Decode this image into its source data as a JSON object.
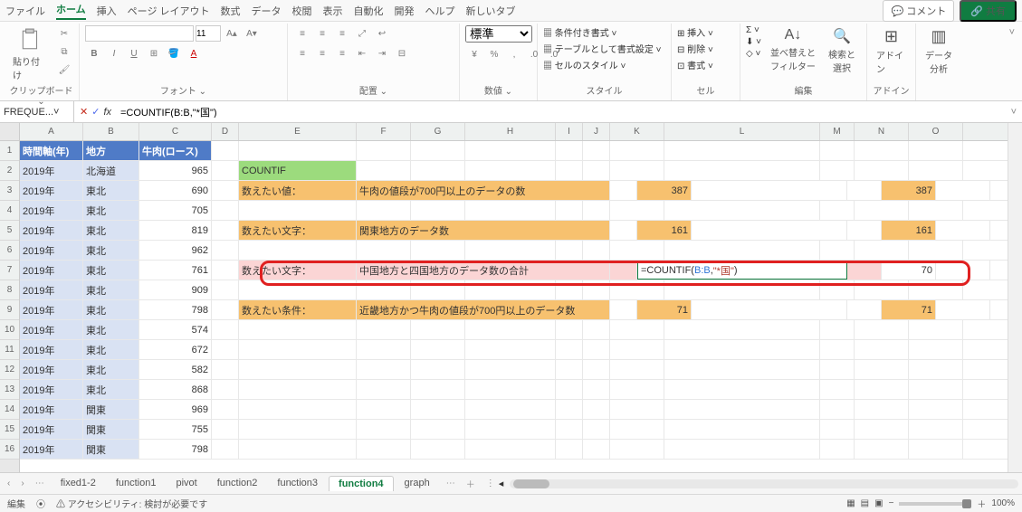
{
  "menu": {
    "items": [
      "ファイル",
      "ホーム",
      "挿入",
      "ページ レイアウト",
      "数式",
      "データ",
      "校閲",
      "表示",
      "自動化",
      "開発",
      "ヘルプ",
      "新しいタブ"
    ],
    "active": 1,
    "comment": "コメント",
    "share": "共有"
  },
  "ribbon": {
    "clipboard": {
      "paste": "貼り付け",
      "label": "クリップボード"
    },
    "font": {
      "family": "",
      "size": "11",
      "label": "フォント"
    },
    "align": {
      "label": "配置"
    },
    "number": {
      "format": "標準",
      "label": "数値"
    },
    "styles": {
      "cond": "条件付き書式",
      "table": "テーブルとして書式設定",
      "cell": "セルのスタイル",
      "label": "スタイル"
    },
    "cells": {
      "insert": "挿入",
      "delete": "削除",
      "format": "書式",
      "label": "セル"
    },
    "editing": {
      "sort": "並べ替えと\nフィルター",
      "find": "検索と\n選択",
      "label": "編集"
    },
    "addin": {
      "name": "アドイン",
      "label": "アドイン"
    },
    "analysis": {
      "name": "データ\n分析",
      "label": ""
    }
  },
  "formula_bar": {
    "name_box": "FREQUE...",
    "formula": "=COUNTIF(B:B,\"*国\")"
  },
  "columns": [
    "A",
    "B",
    "C",
    "D",
    "E",
    "F",
    "G",
    "H",
    "I",
    "J",
    "K",
    "L",
    "M",
    "N",
    "O"
  ],
  "headers": {
    "A": "時間軸(年)",
    "B": "地方",
    "C": "牛肉(ロース)"
  },
  "rows": [
    {
      "A": "2019年",
      "B": "北海道",
      "C": "965"
    },
    {
      "A": "2019年",
      "B": "東北",
      "C": "690"
    },
    {
      "A": "2019年",
      "B": "東北",
      "C": "705"
    },
    {
      "A": "2019年",
      "B": "東北",
      "C": "819"
    },
    {
      "A": "2019年",
      "B": "東北",
      "C": "962"
    },
    {
      "A": "2019年",
      "B": "東北",
      "C": "761"
    },
    {
      "A": "2019年",
      "B": "東北",
      "C": "909"
    },
    {
      "A": "2019年",
      "B": "東北",
      "C": "798"
    },
    {
      "A": "2019年",
      "B": "東北",
      "C": "574"
    },
    {
      "A": "2019年",
      "B": "東北",
      "C": "672"
    },
    {
      "A": "2019年",
      "B": "東北",
      "C": "582"
    },
    {
      "A": "2019年",
      "B": "東北",
      "C": "868"
    },
    {
      "A": "2019年",
      "B": "関東",
      "C": "969"
    },
    {
      "A": "2019年",
      "B": "関東",
      "C": "755"
    },
    {
      "A": "2019年",
      "B": "関東",
      "C": "798"
    }
  ],
  "side": {
    "countif": "COUNTIF",
    "r3": {
      "label": "数えたい値：",
      "desc": "牛肉の値段が700円以上のデータの数",
      "K": "387",
      "N": "387"
    },
    "r5": {
      "label": "数えたい文字：",
      "desc": "関東地方のデータ数",
      "K": "161",
      "N": "161"
    },
    "r7": {
      "label": "数えたい文字：",
      "desc": "中国地方と四国地方のデータ数の合計",
      "K_formula_fn": "=COUNTIF(",
      "K_formula_ref": "B:B",
      "K_formula_mid": ",",
      "K_formula_str": "\"*国\"",
      "K_formula_end": ")",
      "N": "70"
    },
    "r9": {
      "label": "数えたい条件：",
      "desc": "近畿地方かつ牛肉の値段が700円以上のデータ数",
      "K": "71",
      "N": "71"
    }
  },
  "sheets": {
    "items": [
      "fixed1-2",
      "function1",
      "pivot",
      "function2",
      "function3",
      "function4",
      "graph"
    ],
    "active": 5
  },
  "status": {
    "mode": "編集",
    "access": "アクセシビリティ: 検討が必要です",
    "zoom": "100%"
  }
}
